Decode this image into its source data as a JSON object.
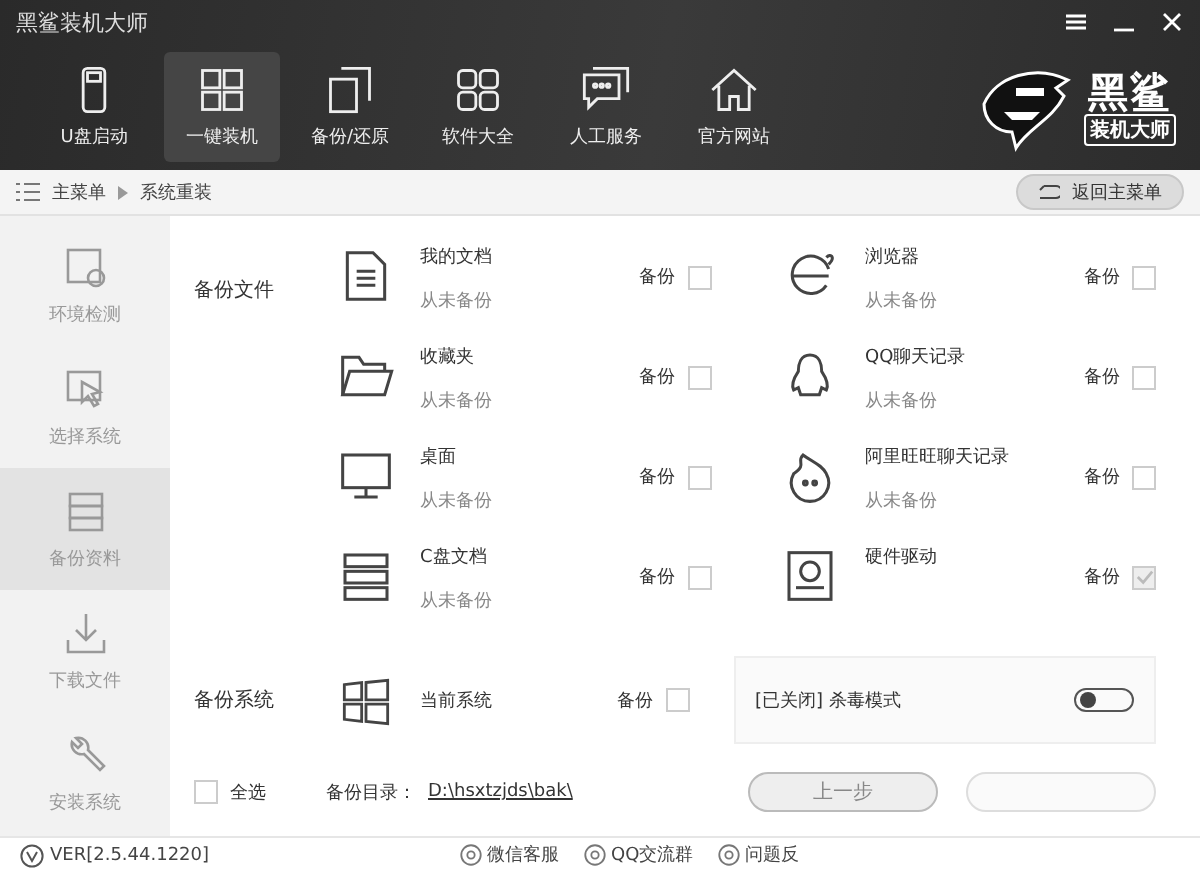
{
  "window": {
    "title": "黑鲨装机大师"
  },
  "nav": [
    {
      "label": "U盘启动",
      "selected": false
    },
    {
      "label": "一键装机",
      "selected": true
    },
    {
      "label": "备份/还原",
      "selected": false
    },
    {
      "label": "软件大全",
      "selected": false
    },
    {
      "label": "人工服务",
      "selected": false
    },
    {
      "label": "官方网站",
      "selected": false
    }
  ],
  "logo": {
    "line_1": "黑鲨",
    "line_2": "装机大师"
  },
  "breadcrumb": [
    "主菜单",
    "系统重装"
  ],
  "back_button": "返回主菜单",
  "sidebar": [
    {
      "label": "环境检测",
      "selected": false
    },
    {
      "label": "选择系统",
      "selected": false
    },
    {
      "label": "备份资料",
      "selected": true
    },
    {
      "label": "下载文件",
      "selected": false
    },
    {
      "label": "安装系统",
      "selected": false
    }
  ],
  "backup_files": {
    "label": "备份文件",
    "items": [
      {
        "name": "我的文档",
        "status": "从未备份",
        "option": "备份",
        "checked": false,
        "disabled": false
      },
      {
        "name": "浏览器",
        "status": "从未备份",
        "option": "备份",
        "checked": false,
        "disabled": false
      },
      {
        "name": "收藏夹",
        "status": "从未备份",
        "option": "备份",
        "checked": false,
        "disabled": false
      },
      {
        "name": "QQ聊天记录",
        "status": "从未备份",
        "option": "备份",
        "checked": false,
        "disabled": false
      },
      {
        "name": "桌面",
        "status": "从未备份",
        "option": "备份",
        "checked": false,
        "disabled": false
      },
      {
        "name": "阿里旺旺聊天记录",
        "status": "从未备份",
        "option": "备份",
        "checked": false,
        "disabled": false
      },
      {
        "name": "C盘文档",
        "status": "从未备份",
        "option": "备份",
        "checked": false,
        "disabled": false
      },
      {
        "name": "硬件驱动",
        "option": "备份",
        "checked": true,
        "disabled": true
      }
    ]
  },
  "backup_system": {
    "label": "备份系统",
    "item": {
      "name": "当前系统",
      "option": "备份",
      "checked": false
    },
    "antivirus": {
      "label": "[已关闭] 杀毒模式",
      "on": false
    }
  },
  "select_all": {
    "label": "全选",
    "checked": false
  },
  "backup_dir": {
    "label": "备份目录：",
    "path": "D:\\hsxtzjds\\bak\\"
  },
  "buttons": [
    {
      "kind": "previous",
      "label": "上一步"
    },
    {
      "kind": "next"
    }
  ],
  "status_bar": {
    "version": "VER[2.5.44.1220]",
    "links": [
      "微信客服",
      "QQ交流群",
      "问题反"
    ]
  }
}
